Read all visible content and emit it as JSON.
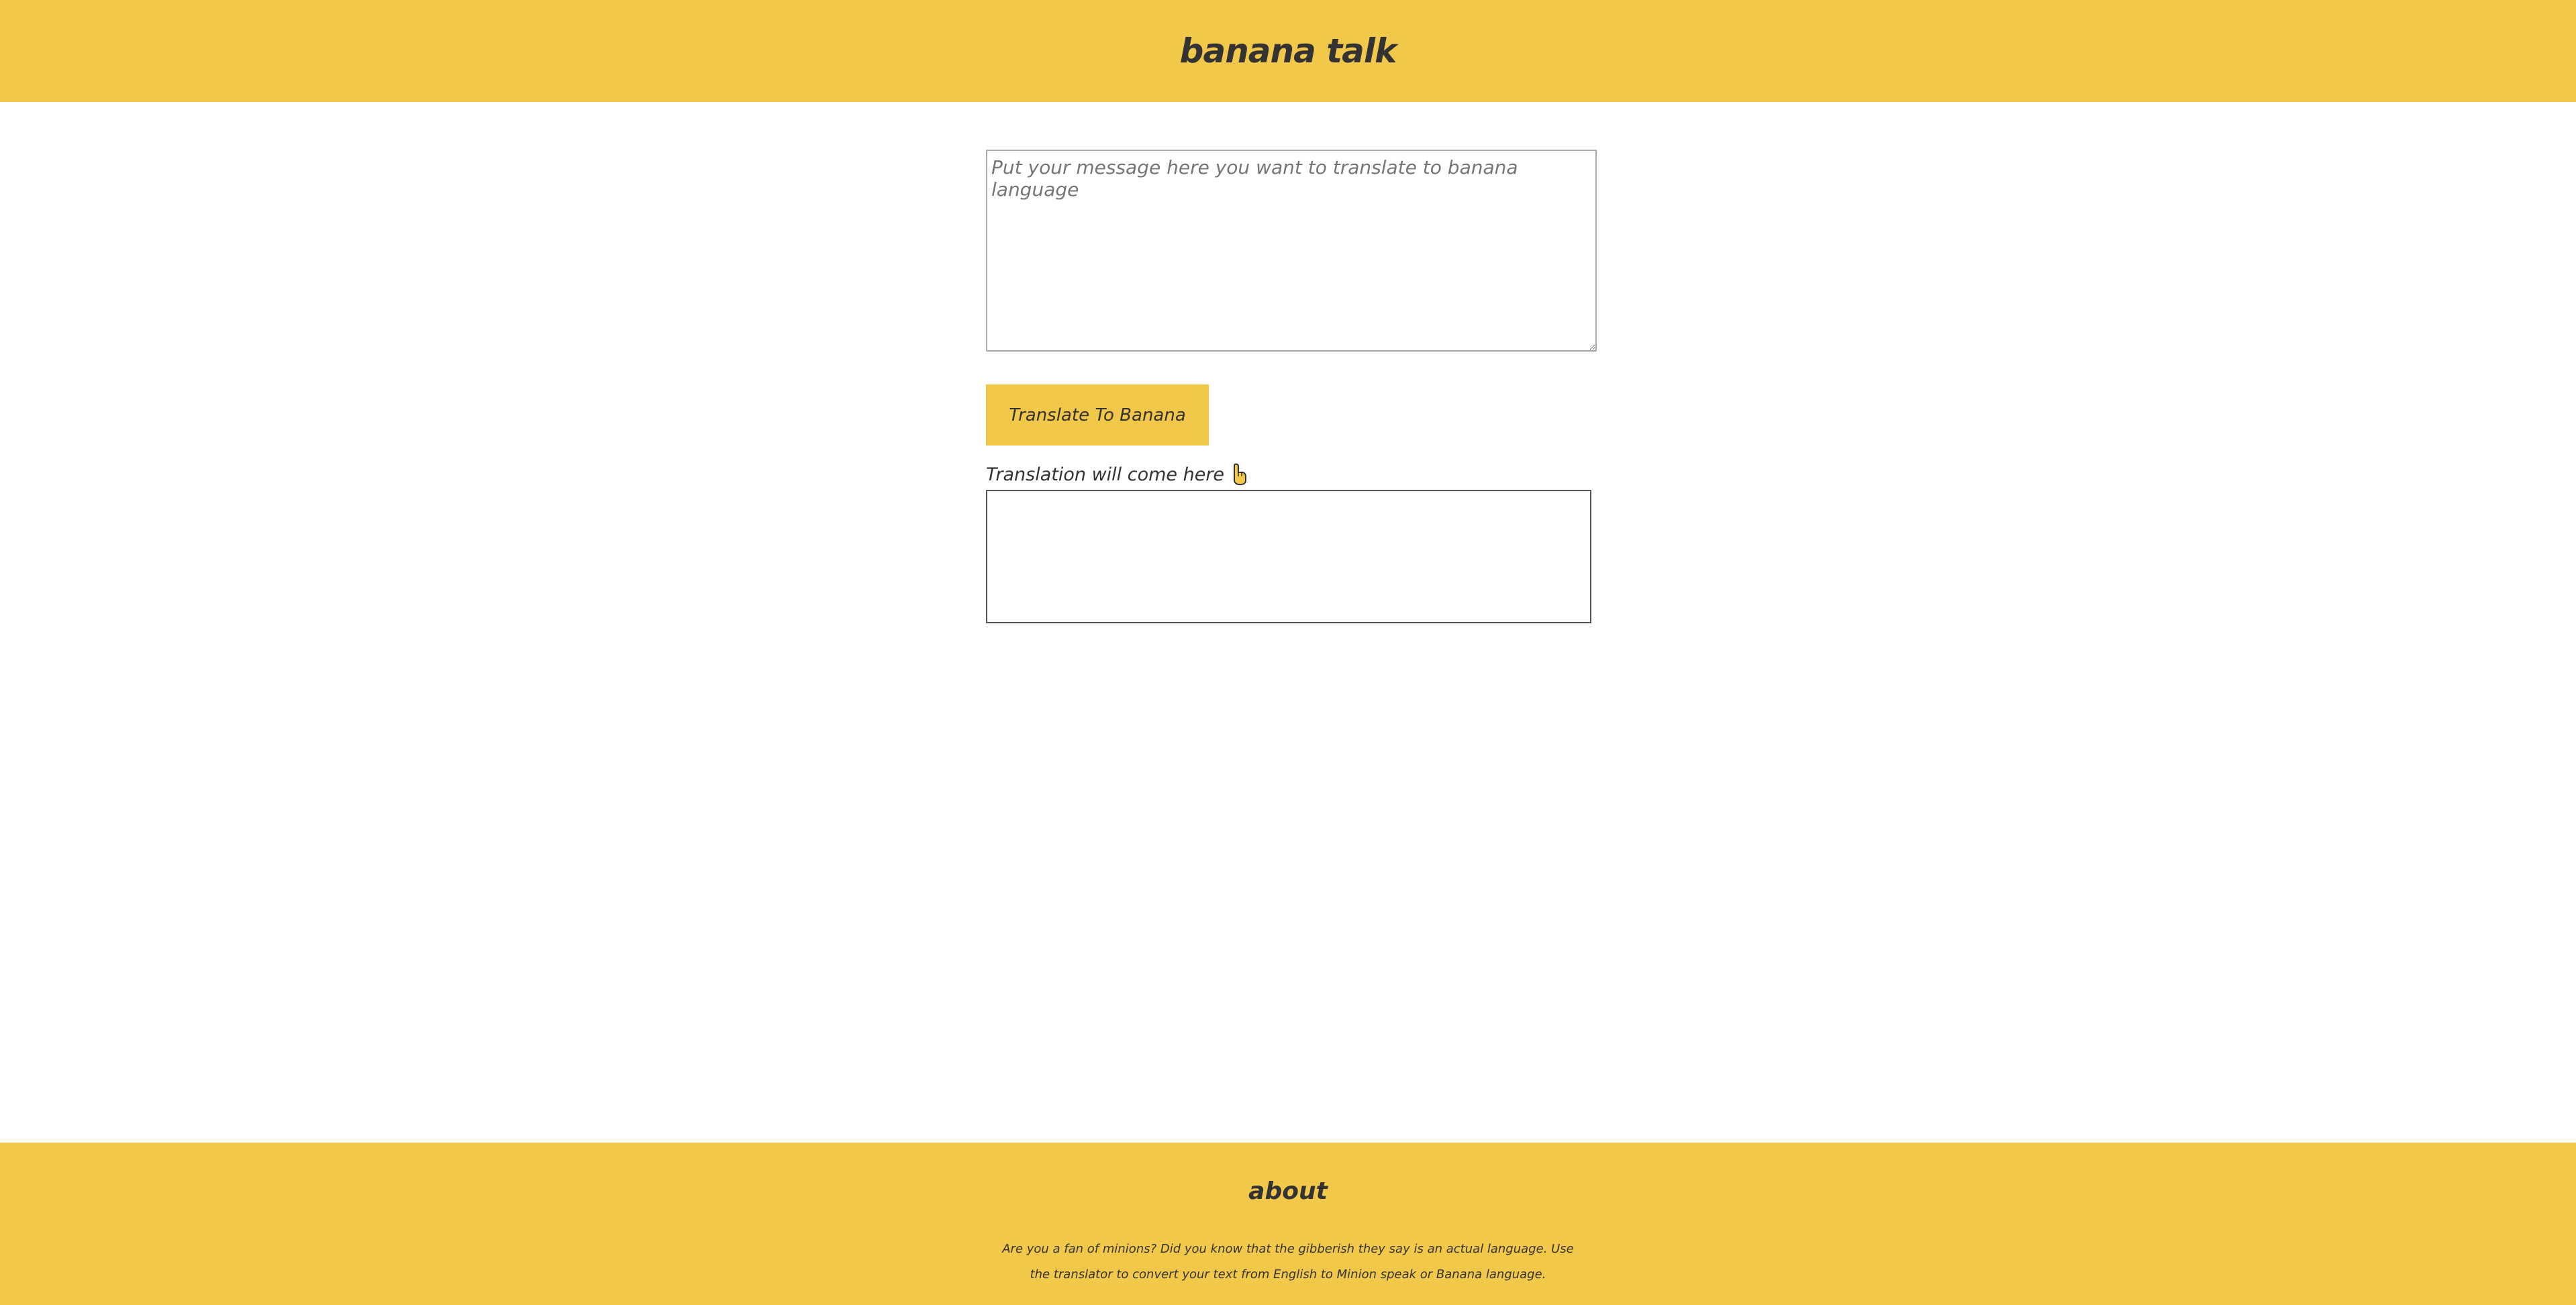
{
  "header": {
    "title": "banana talk"
  },
  "translator": {
    "input_placeholder": "Put your message here you want to translate to banana language",
    "input_value": "",
    "button_label": "Translate To Banana",
    "output_label": "Translation will come here",
    "output_icon": "pointing-hand-down-icon",
    "output_value": ""
  },
  "footer": {
    "heading": "about",
    "description": "Are you a fan of minions? Did you know that the gibberish they say is an actual language. Use the translator to convert your text from English to Minion speak or Banana language."
  },
  "colors": {
    "accent": "#f2c84b",
    "text": "#333333",
    "background": "#ffffff"
  }
}
